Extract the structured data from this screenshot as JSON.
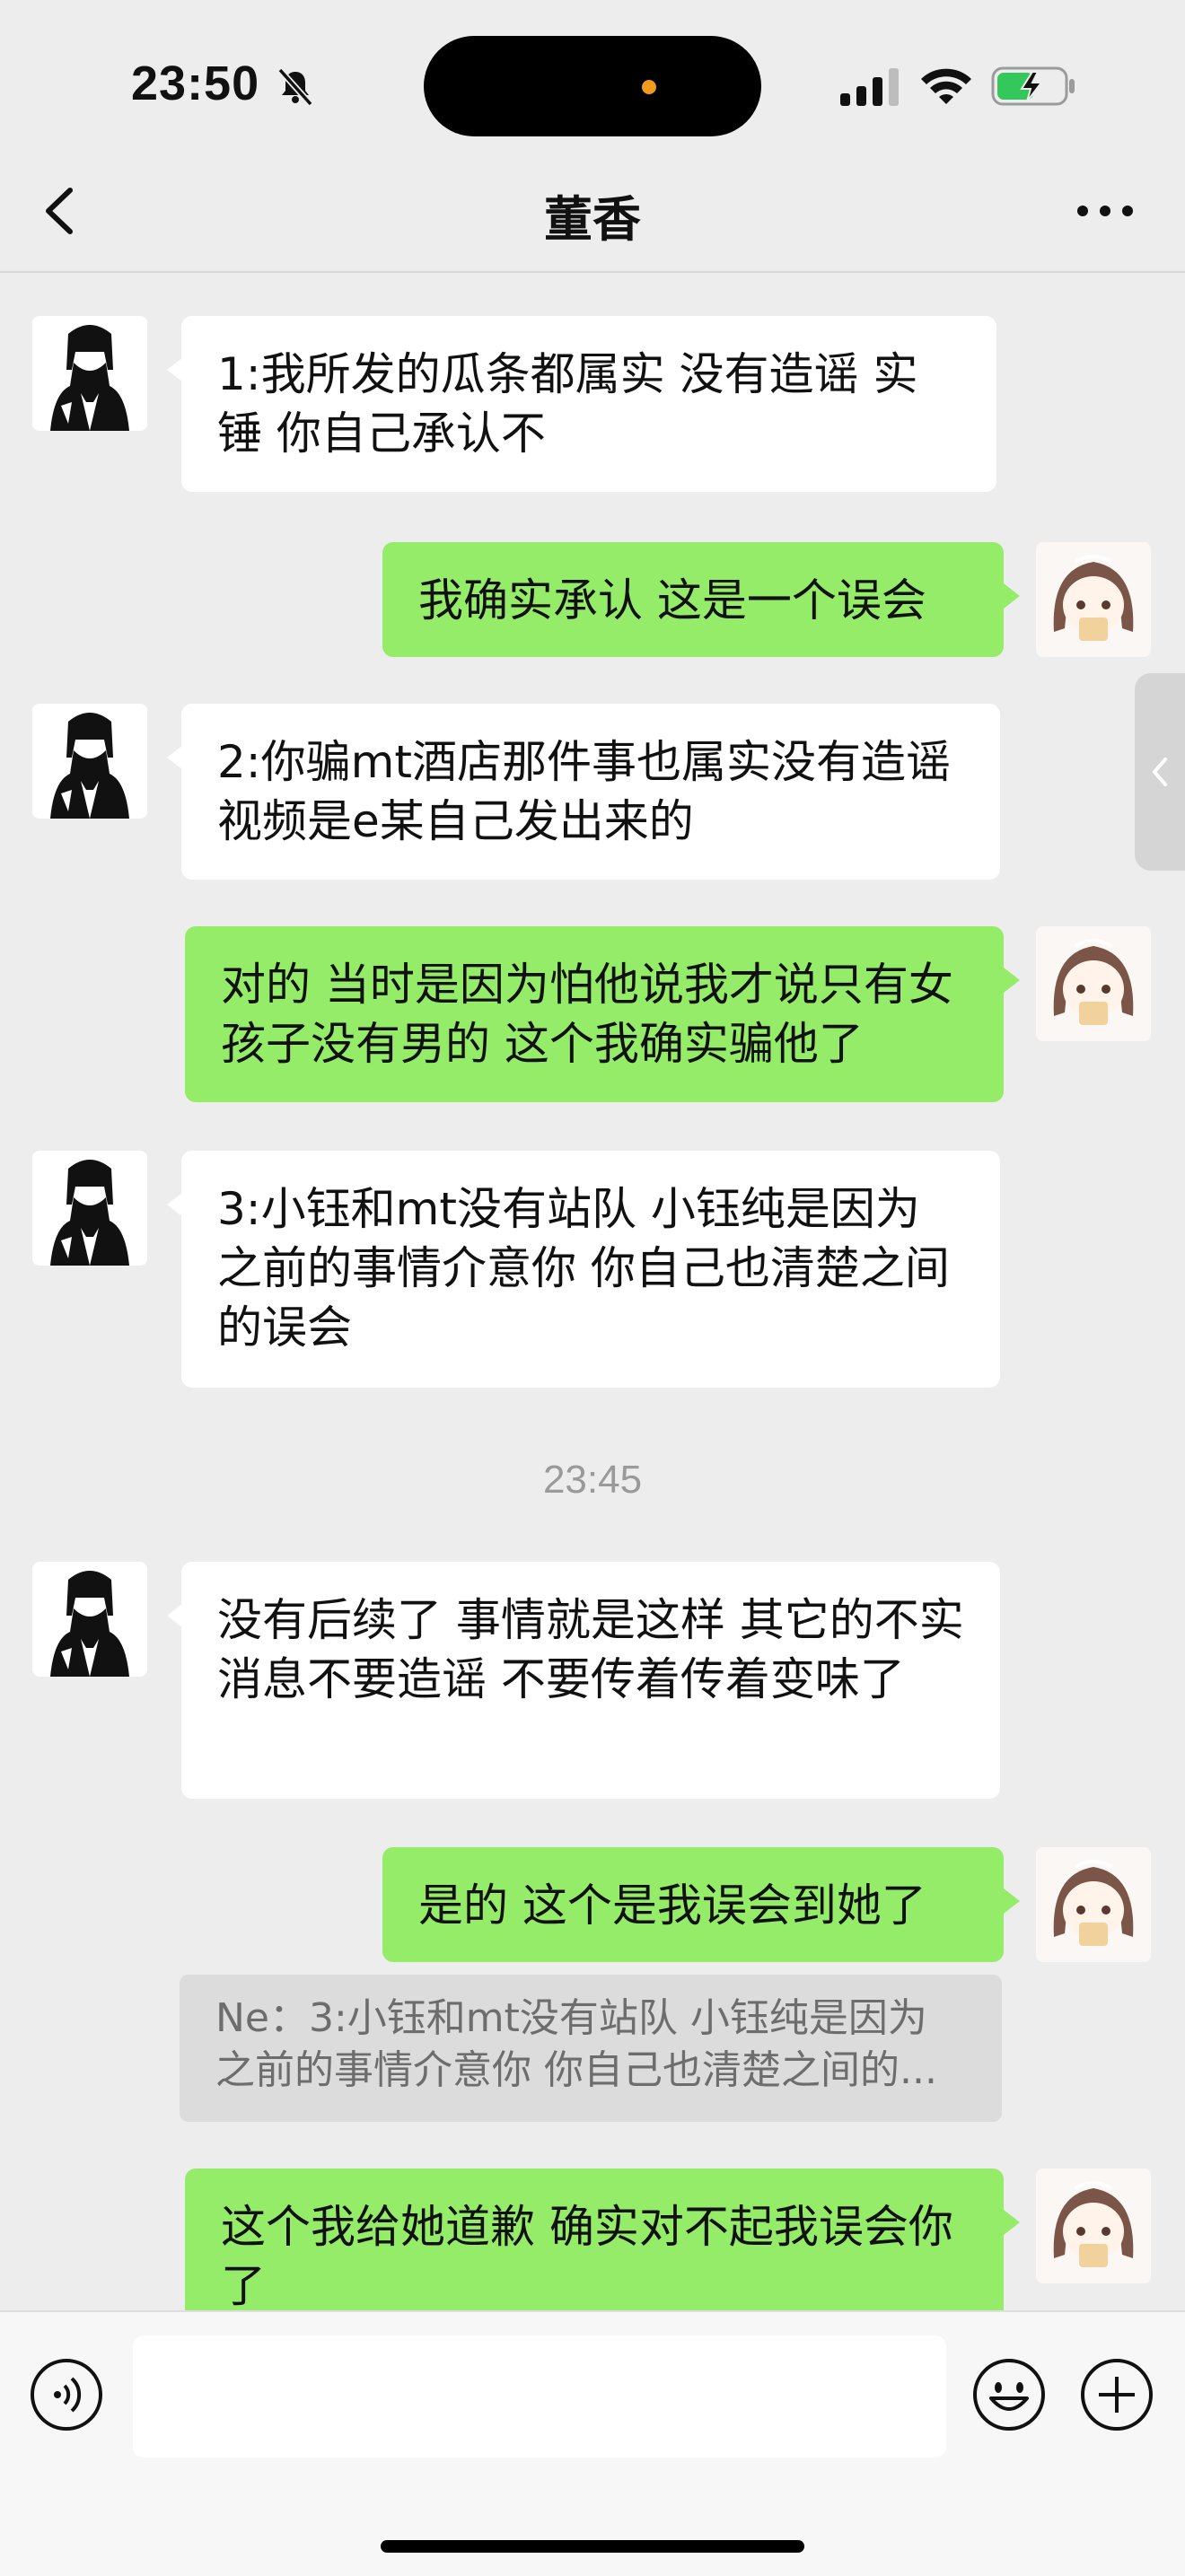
{
  "status_bar": {
    "time": "23:50"
  },
  "header": {
    "title": "董香"
  },
  "messages": [
    {
      "from": "them",
      "text": "1:我所发的瓜条都属实 没有造谣 实锤 你自己承认不"
    },
    {
      "from": "me",
      "text": "我确实承认 这是一个误会"
    },
    {
      "from": "them",
      "text": "2:你骗mt酒店那件事也属实没有造谣 视频是e某自己发出来的"
    },
    {
      "from": "me",
      "text": "对的 当时是因为怕他说我才说只有女孩子没有男的 这个我确实骗他了"
    },
    {
      "from": "them",
      "text": "3:小钰和mt没有站队 小钰纯是因为之前的事情介意你 你自己也清楚之间的误会"
    },
    {
      "from": "them",
      "text": "没有后续了 事情就是这样 其它的不实消息不要造谣 不要传着传着变味了"
    },
    {
      "from": "me",
      "text": "是的 这个是我误会到她了"
    },
    {
      "from": "me",
      "text": "这个我给她道歉 确实对不起我误会你了"
    }
  ],
  "timestamp": "23:45",
  "quote": {
    "line1": "Ne：3:小钰和mt没有站队 小钰纯是因为",
    "line2": "之前的事情介意你 你自己也清楚之间的..."
  },
  "colors": {
    "background": "#ededed",
    "outgoing_bubble": "#95ec69",
    "incoming_bubble": "#ffffff",
    "quote_bg": "#dcdcdc"
  },
  "icons": {
    "back": "chevron-left-icon",
    "more": "more-dots-icon",
    "voice": "voice-icon",
    "emoji": "emoji-icon",
    "plus": "plus-icon"
  }
}
